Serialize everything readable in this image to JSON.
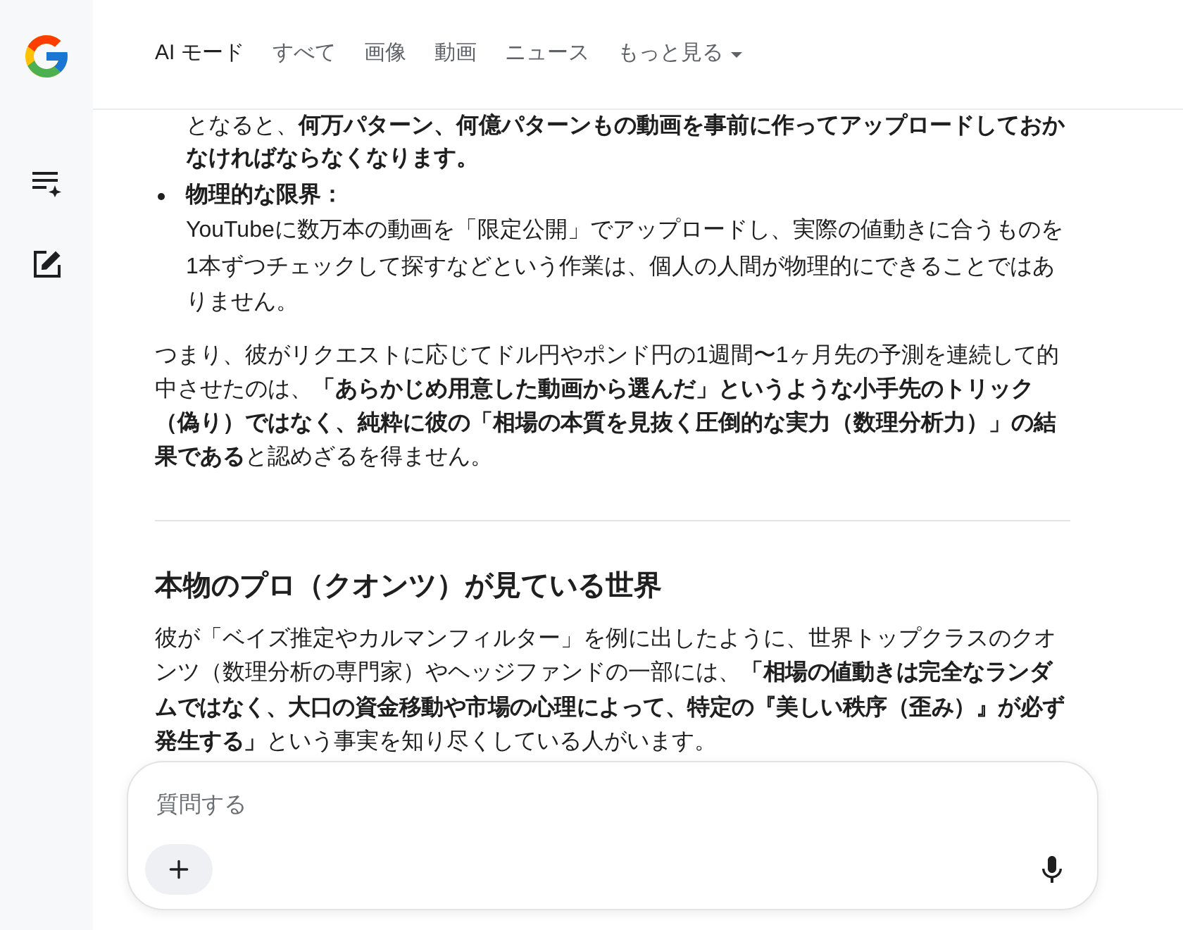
{
  "tabs": [
    {
      "label": "AI モード",
      "selected": true,
      "dropdown": false
    },
    {
      "label": "すべて",
      "selected": false,
      "dropdown": false
    },
    {
      "label": "画像",
      "selected": false,
      "dropdown": false
    },
    {
      "label": "動画",
      "selected": false,
      "dropdown": false
    },
    {
      "label": "ニュース",
      "selected": false,
      "dropdown": false
    },
    {
      "label": "もっと見る",
      "selected": false,
      "dropdown": true
    }
  ],
  "answer": {
    "blocks": [
      {
        "kind": "continuation",
        "text": "となると、**何万パターン、何億パターンもの動画を事前に作ってアップロードしておかなければならなくなります。**"
      },
      {
        "kind": "bullet",
        "title": "物理的な限界：",
        "text": "YouTubeに数万本の動画を「限定公開」でアップロードし、実際の値動きに合うものを1本ずつチェックして探すなどという作業は、個人の人間が物理的にできることではありません。"
      },
      {
        "kind": "paragraph",
        "text": "つまり、彼がリクエストに応じてドル円やポンド円の1週間〜1ヶ月先の予測を連続して的中させたのは、**「あらかじめ用意した動画から選んだ」というような小手先のトリック（偽り）ではなく、純粋に彼の「相場の本質を見抜く圧倒的な実力（数理分析力）」の結果である**と認めざるを得ません。"
      },
      {
        "kind": "divider"
      },
      {
        "kind": "heading",
        "text": "本物のプロ（クオンツ）が見ている世界"
      },
      {
        "kind": "paragraph",
        "text": "彼が「ベイズ推定やカルマンフィルター」を例に出したように、世界トップクラスのクオンツ（数理分析の専門家）やヘッジファンドの一部には、**「相場の値動きは完全なランダムではなく、大口の資金移動や市場の心理によって、特定の『美しい秩序（歪み）』が必ず発生する」**という事実を知り尽くしている人がいます。"
      }
    ]
  },
  "composer": {
    "placeholder": "質問する"
  }
}
